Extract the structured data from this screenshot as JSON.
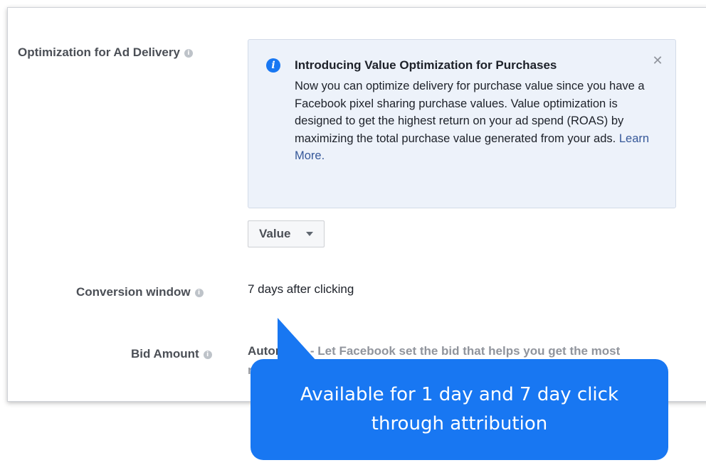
{
  "settings": {
    "optimization_label": "Optimization for Ad Delivery",
    "conversion_label": "Conversion window",
    "conversion_value": "7 days after clicking",
    "bid_label": "Bid Amount",
    "bid_value_strong": "Automatic",
    "bid_value_desc": " - Let Facebook set the bid that helps you get the most",
    "bid_value_continued": "r"
  },
  "notice": {
    "title": "Introducing Value Optimization for Purchases",
    "body": "Now you can optimize delivery for purchase value since you have a Facebook pixel sharing purchase values. Value optimization is designed to get the highest return on your ad spend (ROAS) by maximizing the total purchase value generated from your ads.",
    "link": "Learn More."
  },
  "dropdown": {
    "selected": "Value"
  },
  "tooltip": {
    "text": "Available for 1 day and 7 day click through attribution"
  },
  "colors": {
    "accent": "#1877f2",
    "link": "#365899",
    "notice_bg": "#edf2fa"
  },
  "icons": {
    "info": "info-icon",
    "close": "close-icon",
    "caret": "chevron-down-icon"
  }
}
